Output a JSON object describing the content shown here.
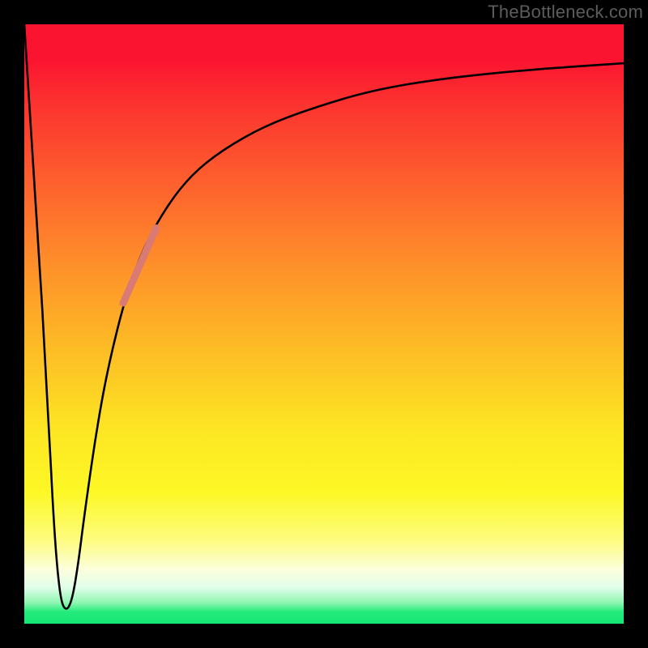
{
  "watermark": "TheBottleneck.com",
  "chart_data": {
    "type": "line",
    "title": "",
    "xlabel": "",
    "ylabel": "",
    "xlim": [
      0,
      100
    ],
    "ylim": [
      0,
      100
    ],
    "background": "rainbow-gradient (red top → green bottom)",
    "series": [
      {
        "name": "main-curve",
        "color": "#000000",
        "width": 2.5,
        "x": [
          0,
          2,
          4,
          5,
          6,
          7,
          8,
          9,
          10,
          12,
          14,
          17,
          20,
          24,
          28,
          33,
          40,
          48,
          58,
          70,
          85,
          100
        ],
        "y": [
          100,
          70,
          35,
          15,
          4,
          2,
          4,
          10,
          18,
          32,
          43,
          55,
          63,
          70,
          75,
          79,
          83,
          86,
          89,
          91,
          92.5,
          93.5
        ]
      },
      {
        "name": "highlight-segment",
        "color": "#d97b74",
        "width": 9,
        "x": [
          16.5,
          22.0
        ],
        "y": [
          53.5,
          66.0
        ]
      }
    ],
    "gradient_stops": [
      {
        "pos": 0.0,
        "color": "#fb1430"
      },
      {
        "pos": 0.12,
        "color": "#fc2e2f"
      },
      {
        "pos": 0.25,
        "color": "#fd5b2e"
      },
      {
        "pos": 0.4,
        "color": "#fe8f2a"
      },
      {
        "pos": 0.55,
        "color": "#fdbf25"
      },
      {
        "pos": 0.68,
        "color": "#fde624"
      },
      {
        "pos": 0.78,
        "color": "#fdf825"
      },
      {
        "pos": 0.86,
        "color": "#fdfc7e"
      },
      {
        "pos": 0.91,
        "color": "#fcfedd"
      },
      {
        "pos": 0.94,
        "color": "#e0feea"
      },
      {
        "pos": 0.965,
        "color": "#8ef7b0"
      },
      {
        "pos": 0.98,
        "color": "#24ea7c"
      },
      {
        "pos": 1.0,
        "color": "#15e674"
      }
    ]
  }
}
